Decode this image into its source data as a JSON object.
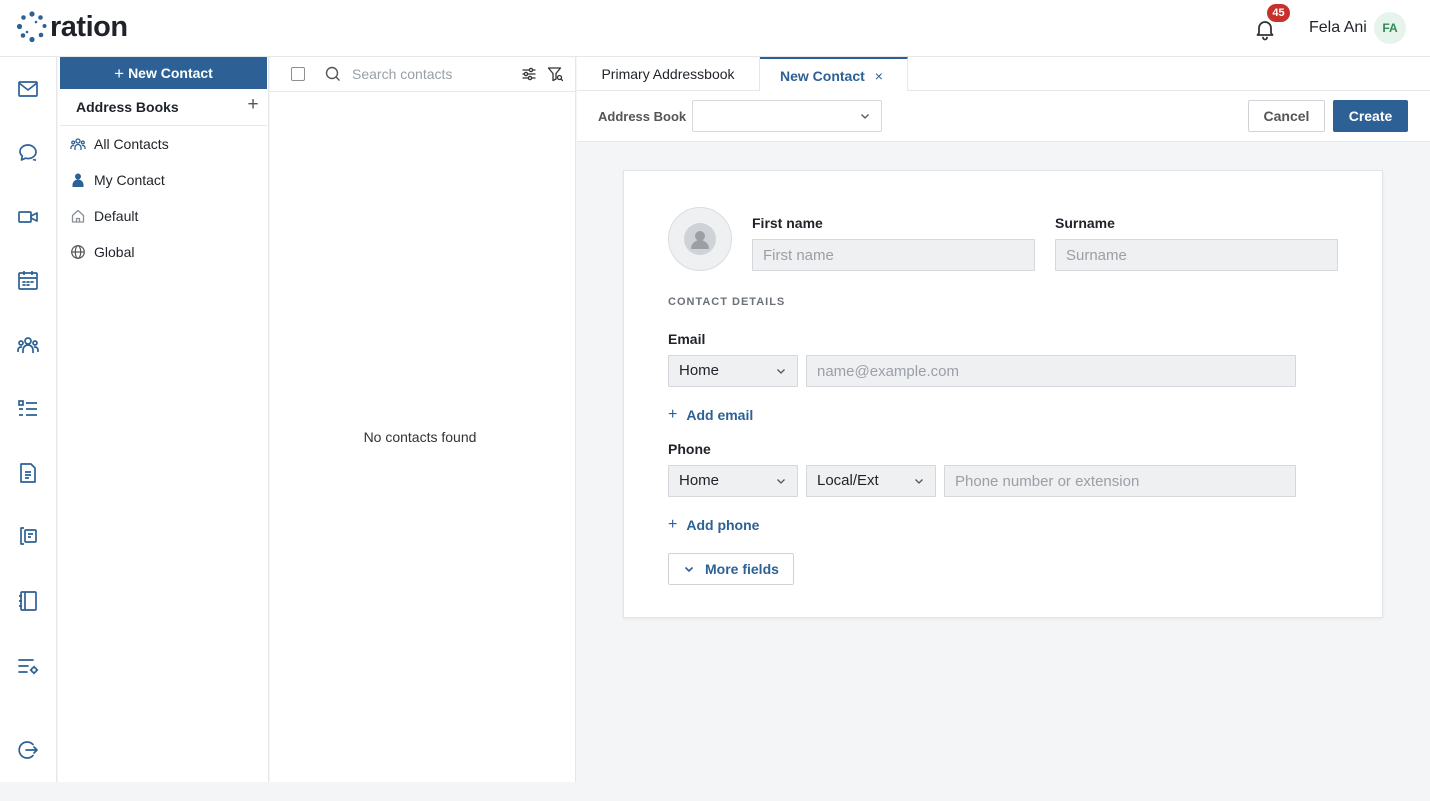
{
  "header": {
    "logo_text": "ration",
    "notification_count": "45",
    "user_name": "Fela Ani",
    "user_initials": "FA"
  },
  "rail": {
    "icons": [
      "mail-icon",
      "chat-icon",
      "video-icon",
      "calendar-icon",
      "contacts-icon",
      "tasks-icon",
      "document-icon",
      "sms-icon",
      "notebook-icon",
      "settings-list-icon",
      "logout-icon"
    ]
  },
  "address_books": {
    "new_contact_label": "New Contact",
    "heading": "Address Books",
    "items": [
      {
        "label": "All Contacts",
        "icon": "people-icon"
      },
      {
        "label": "My Contact",
        "icon": "person-icon"
      },
      {
        "label": "Default",
        "icon": "home-icon"
      },
      {
        "label": "Global",
        "icon": "globe-icon"
      }
    ]
  },
  "contact_list": {
    "search_placeholder": "Search contacts",
    "empty_message": "No contacts found"
  },
  "tabs": [
    {
      "label": "Primary Addressbook",
      "active": false
    },
    {
      "label": "New Contact",
      "active": true,
      "close": "×"
    }
  ],
  "toolbar": {
    "address_book_label": "Address Book",
    "address_book_value": "",
    "cancel_label": "Cancel",
    "create_label": "Create"
  },
  "form": {
    "first_name_label": "First name",
    "first_name_placeholder": "First name",
    "surname_label": "Surname",
    "surname_placeholder": "Surname",
    "section_title": "CONTACT DETAILS",
    "email_label": "Email",
    "email_type": "Home",
    "email_placeholder": "name@example.com",
    "add_email_label": "Add email",
    "phone_label": "Phone",
    "phone_type": "Home",
    "phone_kind": "Local/Ext",
    "phone_placeholder": "Phone number or extension",
    "add_phone_label": "Add phone",
    "more_fields_label": "More fields"
  },
  "colors": {
    "primary": "#2d6195",
    "badge": "#c6322b",
    "avatar_bg": "#e7f4ec",
    "avatar_text": "#2f8a55"
  }
}
